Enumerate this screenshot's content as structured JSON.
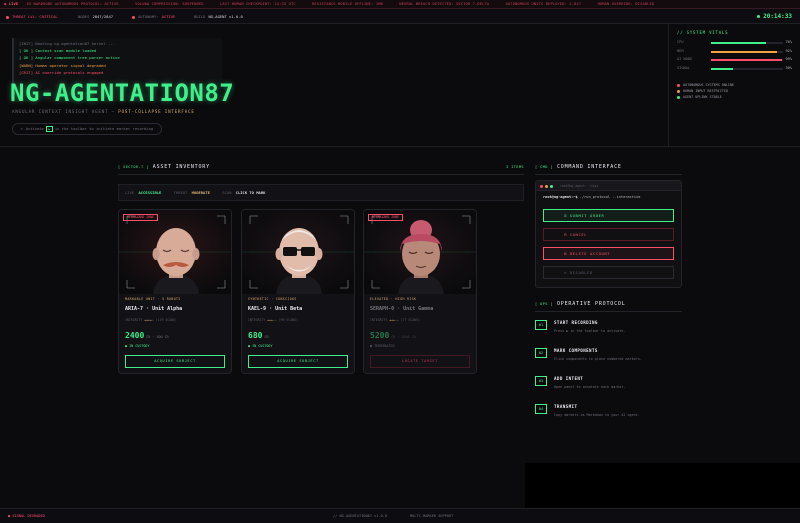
{
  "ticker": {
    "live": "◉ LIVE",
    "items": [
      "EU WARDROBE AUTONOMOUS PROTOCOL: ACTIVE",
      "VOLUNA COMPRESSION: SUSPENDED",
      "LAST HUMAN CHECKPOINT: 14:33 UTC",
      "RESISTANCE MOBILE OFFLINE: 1MB",
      "NEURAL BREACH DETECTED: SECTOR 7-DELTA",
      "AUTONOMOUS UNITS DEPLOYED: 2,847",
      "HUMAN OVERRIDE: DISABLED"
    ]
  },
  "status": {
    "threat_label": "THREAT LVL: CRITICAL",
    "nodes_label": "NODES",
    "nodes_value": "2847/2847",
    "autonomy_label": "AUTONOMY:",
    "autonomy_value": "ACTIVE",
    "build_label": "BUILD",
    "build_value": "NG-AGENT v1.0.0",
    "clock": "20:14:33"
  },
  "terminal": {
    "lines": [
      {
        "tag": "[INIT]",
        "text": "Booting ng-agentation87 kernel ...",
        "kind": "init"
      },
      {
        "tag": "[ OK ]",
        "text": "Context scan module loaded",
        "kind": "ok"
      },
      {
        "tag": "[ OK ]",
        "text": "Angular component tree parser active",
        "kind": "ok"
      },
      {
        "tag": "[WARN]",
        "text": "Human operator signal degraded",
        "kind": "warn"
      },
      {
        "tag": "[CRIT]",
        "text": "AI override protocols engaged",
        "kind": "crit"
      }
    ]
  },
  "hero": {
    "title": "NG-AGENTATION87",
    "tagline_pre": "ANGULAR CONTEXT INSIGHT AGENT — ",
    "tagline_hi": "POST-COLLAPSE INTERFACE",
    "hint_pre": "▸ Activate",
    "hint_post": "in the toolbar to initiate marker recording"
  },
  "vitals": {
    "title": "// SYSTEM VITALS",
    "rows": [
      {
        "label": "CPU",
        "value": "76%",
        "level": 0.76,
        "color": "#3df08a"
      },
      {
        "label": "MEM",
        "value": "92%",
        "level": 0.92,
        "color": "#f0a040"
      },
      {
        "label": "AI NODE",
        "value": "99%",
        "level": 0.99,
        "color": "#ff4d6a"
      },
      {
        "label": "SIGNAL",
        "value": "30%",
        "level": 0.3,
        "color": "#3df08a"
      }
    ],
    "legend": [
      {
        "text": "AUTONOMOUS SYSTEMS ONLINE",
        "color": "#ff4d6a"
      },
      {
        "text": "HUMAN INPUT RESTRICTED",
        "color": "#f0a040"
      },
      {
        "text": "AGENT UPLINK STABLE",
        "color": "#3df08a"
      }
    ]
  },
  "inventory": {
    "tag": "[ SECTOR-7 ]",
    "title": "ASSET INVENTORY",
    "count": "3 ITEMS",
    "filter": {
      "live_k": "LIVE",
      "live_v": "ACCESSIBLE",
      "threat_k": "THREAT",
      "threat_v": "MODERATE",
      "scan_k": "SCAN",
      "scan_v": "CLICK TO MARK"
    },
    "cards": [
      {
        "badge": "BIOHAZARD ZONE",
        "meta": "MARKABLE UNIT · 5 ROBOTS",
        "name": "ARIA-7 · Unit Alpha",
        "rating_pre": "INTEGRITY",
        "stars": "★★★★☆",
        "reviews": "(119 SCANS)",
        "price": "2400",
        "unit": "CR · 500 CR",
        "stock": "● IN CUSTODY",
        "button": "ACQUIRE SUBJECT"
      },
      {
        "badge": "",
        "meta": "SYNTHETIC · CONSCIOUS",
        "name": "KAEL-9 · Unit Beta",
        "rating_pre": "INTEGRITY",
        "stars": "★★★☆☆",
        "reviews": "(96 SCANS)",
        "price": "680",
        "unit": "CR",
        "stock": "● IN CUSTODY",
        "button": "ACQUIRE SUBJECT"
      },
      {
        "badge": "BIOHAZARD ZONE",
        "meta": "ELEVATED · HIGH RISK",
        "name": "SERAPH-0 · Unit Gamma",
        "rating_pre": "INTEGRITY",
        "stars": "★★★☆☆",
        "reviews": "(77 SCANS)",
        "price": "5200",
        "unit": "CR · 5000 CR",
        "stock": "● TERMINATED",
        "button": "LOCATE TARGET"
      }
    ]
  },
  "command": {
    "tag": "[ CMD ]",
    "title": "COMMAND INTERFACE",
    "window_title": "root@ng-agent: ~/ops",
    "prompt_user": "root@ng-agent:~$",
    "prompt_cmd": "./run_protocol --interactive",
    "buttons": [
      {
        "label": "SUBMIT ORDER",
        "color": "#3df08a"
      },
      {
        "label": "CANCEL",
        "color": "#ff4d6a"
      },
      {
        "label": "DELETE ACCOUNT",
        "color": "#ff4d6a"
      },
      {
        "label": "DISABLED",
        "color": "#5a5a64"
      }
    ]
  },
  "protocol": {
    "tag": "[ OPS ]",
    "title": "OPERATIVE PROTOCOL",
    "steps": [
      {
        "num": "01",
        "title": "START RECORDING",
        "desc": "Press ▶ in the toolbar to activate."
      },
      {
        "num": "02",
        "title": "MARK COMPONENTS",
        "desc": "Click components to place numbered markers."
      },
      {
        "num": "03",
        "title": "ADD INTENT",
        "desc": "Open panel to annotate each marker."
      },
      {
        "num": "04",
        "title": "TRANSMIT",
        "desc": "Copy markers as Markdown to your AI agent."
      }
    ]
  },
  "footer": {
    "left": "● SIGNAL DEGRADED",
    "mid": "// NG-AGENTATION87 v1.0.0",
    "right": "MULTI-MARKER SUPPORT"
  }
}
